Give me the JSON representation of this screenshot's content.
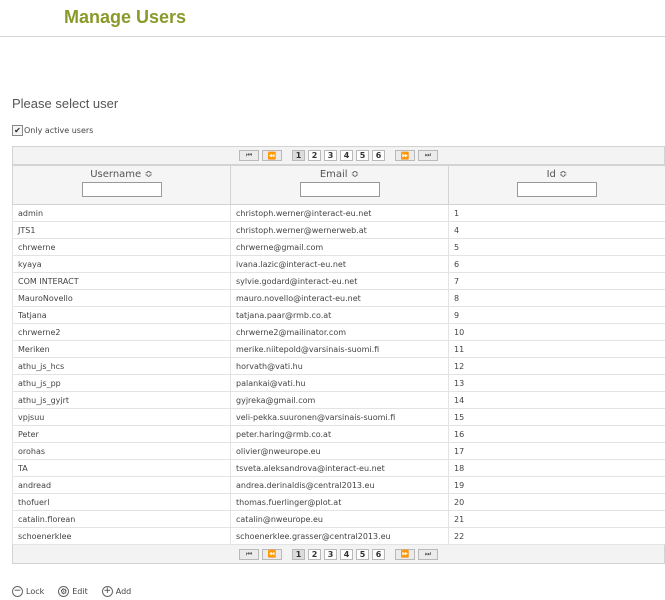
{
  "page": {
    "title": "Manage Users"
  },
  "section": {
    "title": "Please select user"
  },
  "filter": {
    "label": "Only active users",
    "checked": true
  },
  "pager": {
    "first": "⏮",
    "prev": "⏪",
    "next": "⏩",
    "last": "⏭",
    "pages": [
      "1",
      "2",
      "3",
      "4",
      "5",
      "6"
    ],
    "active_page": "1"
  },
  "table": {
    "columns": [
      {
        "label": "Username",
        "sort": "≎"
      },
      {
        "label": "Email",
        "sort": "≎"
      },
      {
        "label": "Id",
        "sort": "≎"
      }
    ],
    "rows": [
      [
        "admin",
        "christoph.werner@interact-eu.net",
        "1"
      ],
      [
        "JTS1",
        "christoph.werner@wernerweb.at",
        "4"
      ],
      [
        "chrwerne",
        "chrwerne@gmail.com",
        "5"
      ],
      [
        "kyaya",
        "ivana.lazic@interact-eu.net",
        "6"
      ],
      [
        "COM INTERACT",
        "sylvie.godard@interact-eu.net",
        "7"
      ],
      [
        "MauroNovello",
        "mauro.novello@interact-eu.net",
        "8"
      ],
      [
        "Tatjana",
        "tatjana.paar@rmb.co.at",
        "9"
      ],
      [
        "chrwerne2",
        "chrwerne2@mailinator.com",
        "10"
      ],
      [
        "Meriken",
        "merike.niitepold@varsinais-suomi.fi",
        "11"
      ],
      [
        "athu_js_hcs",
        "horvath@vati.hu",
        "12"
      ],
      [
        "athu_js_pp",
        "palankai@vati.hu",
        "13"
      ],
      [
        "athu_js_gyjrt",
        "gyjreka@gmail.com",
        "14"
      ],
      [
        "vpjsuu",
        "veli-pekka.suuronen@varsinais-suomi.fi",
        "15"
      ],
      [
        "Peter",
        "peter.haring@rmb.co.at",
        "16"
      ],
      [
        "orohas",
        "olivier@nweurope.eu",
        "17"
      ],
      [
        "TA",
        "tsveta.aleksandrova@interact-eu.net",
        "18"
      ],
      [
        "andread",
        "andrea.derinaldis@central2013.eu",
        "19"
      ],
      [
        "thofuerl",
        "thomas.fuerlinger@plot.at",
        "20"
      ],
      [
        "catalin.florean",
        "catalin@nweurope.eu",
        "21"
      ],
      [
        "schoenerklee",
        "schoenerklee.grasser@central2013.eu",
        "22"
      ]
    ]
  },
  "actions": {
    "lock": {
      "label": "Lock",
      "icon": "minus-circle-icon"
    },
    "edit": {
      "label": "Edit",
      "icon": "gear-circle-icon"
    },
    "add": {
      "label": "Add",
      "icon": "plus-circle-icon"
    }
  },
  "colors": {
    "title": "#8a9a2a",
    "header_bg": "#f5f5f5",
    "border": "#d3d3d3"
  }
}
